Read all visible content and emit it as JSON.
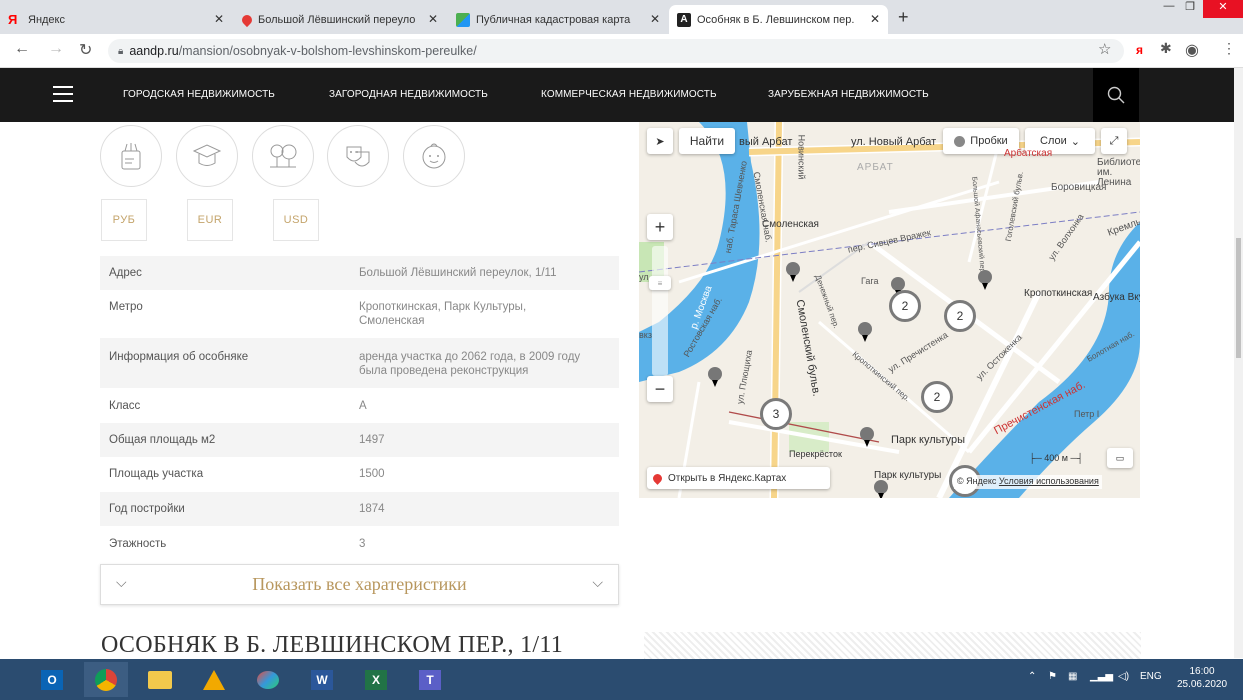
{
  "browser": {
    "tabs": [
      {
        "label": "Яндекс",
        "icon": "yandex-icon"
      },
      {
        "label": "Большой Лёвшинский переуло",
        "icon": "map-pin-icon"
      },
      {
        "label": "Публичная кадастровая карта",
        "icon": "map-icon"
      },
      {
        "label": "Особняк в Б. Левшинском пер.",
        "icon": "aandp-icon"
      }
    ],
    "url_host": "aandp.ru",
    "url_path": "/mansion/osobnyak-v-bolshom-levshinskom-pereulke/"
  },
  "nav": {
    "items": [
      "ГОРОДСКАЯ НЕДВИЖИМОСТЬ",
      "ЗАГОРОДНАЯ НЕДВИЖИМОСТЬ",
      "КОММЕРЧЕСКАЯ НЕДВИЖИМОСТЬ",
      "ЗАРУБЕЖНАЯ НЕДВИЖИМОСТЬ"
    ]
  },
  "amenities": [
    "shop-icon",
    "education-icon",
    "park-icon",
    "theatre-icon",
    "kids-icon"
  ],
  "currencies": [
    "РУБ",
    "EUR",
    "USD"
  ],
  "specs": [
    {
      "key": "Адрес",
      "value": "Большой Лёвшинский переулок, 1/11"
    },
    {
      "key": "Метро",
      "value": "Кропоткинская, Парк Культуры, Смоленская"
    },
    {
      "key": "Информация об особняке",
      "value": "аренда участка до 2062 года, в 2009 году была проведена реконструкция"
    },
    {
      "key": "Класс",
      "value": "A"
    },
    {
      "key": "Общая площадь м2",
      "value": "1497"
    },
    {
      "key": "Площадь участка",
      "value": "1500"
    },
    {
      "key": "Год постройки",
      "value": "1874"
    },
    {
      "key": "Этажность",
      "value": "3"
    }
  ],
  "show_all": "Показать все харатеристики",
  "heading": "ОСОБНЯК В Б. ЛЕВШИНСКОМ ПЕР., 1/11",
  "map": {
    "find": "Найти",
    "traffic": "Пробки",
    "layers": "Слои",
    "open_in": "Открыть в Яндекс.Картах",
    "scale": "400 м",
    "copyright": "© Яндекс",
    "terms": "Условия использования",
    "clusters": [
      "2",
      "2",
      "2",
      "3"
    ],
    "labels": {
      "novy_arbat": "ул. Новый Арбат",
      "novy_arbat2": "вый Арбат",
      "arbat": "АРБАТ",
      "arbatskaya": "Арбатская",
      "smolenskaya": "Смоленская",
      "kropotkinskaya": "Кропоткинская",
      "park_kultury": "Парк культуры",
      "park_kultury2": "Парк культуры",
      "perekrestok": "Перекрёсток",
      "azbuka": "Азбука Вкуса",
      "borovitskaya": "Боровицкая",
      "library": "Библиотека им. Ленина",
      "gaga": "Гага",
      "prechistenka": "ул. Пречистенка",
      "ostozhenka": "ул. Остоженка",
      "volkhonka": "ул. Волхонка",
      "sivtsev": "пер. Сивцев Вражек",
      "moskva": "р. Москва",
      "rostovskaya": "Ростовская наб.",
      "smol_nab": "Смоленская наб.",
      "taras": "наб. Тараса Шевченко",
      "smol_bulv": "Смоленский бульв.",
      "prech_nab": "Пречистенская наб.",
      "denezhny": "Денежный пер.",
      "kropot_per": "Кропоткинский пер.",
      "pluschikha": "ул. Плющиха",
      "petr": "Петр I",
      "bolotnaya": "Болотная наб.",
      "kreml": "Кремль",
      "gogol": "Гоголевский бульв.",
      "afanasyev": "Большой Афанасьевский пер.",
      "novinsky": "Новинский",
      "vk": "вкз",
      "ul": "ул"
    }
  },
  "taskbar": {
    "apps": [
      "outlook-icon",
      "chrome-icon",
      "explorer-icon",
      "acrobat-icon",
      "paint-icon",
      "word-icon",
      "excel-icon",
      "teams-icon"
    ],
    "lang": "ENG",
    "time": "16:00",
    "date": "25.06.2020"
  },
  "colors": {
    "accent": "#c4a46b",
    "navbar": "#1a1a1a",
    "taskbar": "#2b4c70",
    "river": "#5ab1e8"
  }
}
